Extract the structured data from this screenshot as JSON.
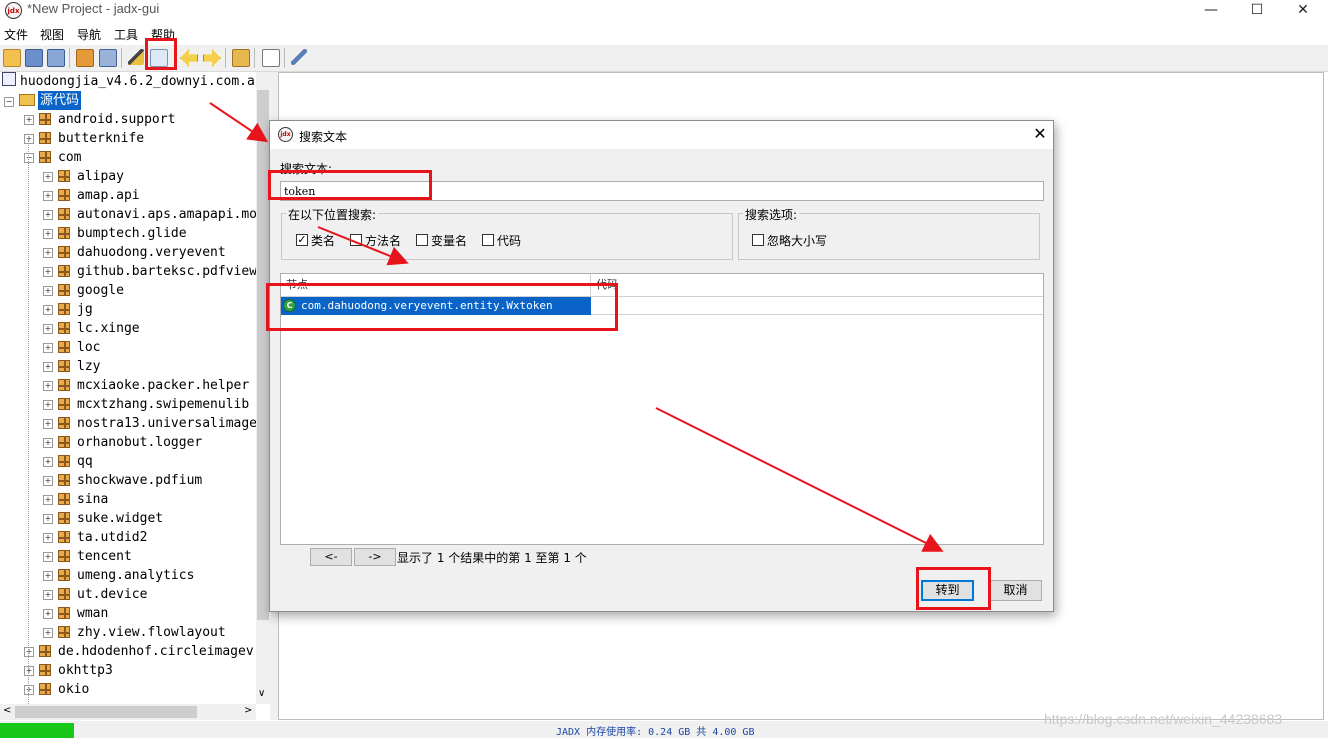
{
  "window": {
    "title": "*New Project - jadx-gui",
    "logo_text": "jdx",
    "minimize": "—",
    "maximize": "☐",
    "close": "✕"
  },
  "menu": [
    "文件",
    "视图",
    "导航",
    "工具",
    "帮助"
  ],
  "toolbar": {
    "icons": [
      "open-folder-icon",
      "add-files-icon",
      "save-all-icon",
      "sync-icon",
      "flatten-packages-icon",
      "decompile-wand-icon",
      "search-text-icon",
      "back-icon",
      "forward-icon",
      "deobfuscate-icon",
      "log-icon",
      "preferences-icon"
    ]
  },
  "tree": {
    "root_label": "huodongjia_v4.6.2_downyi.com.a",
    "source_label": "源代码",
    "items": [
      {
        "label": "android.support",
        "level": 1
      },
      {
        "label": "butterknife",
        "level": 1
      },
      {
        "label": "com",
        "level": 1,
        "expanded": true
      },
      {
        "label": "alipay",
        "level": 2
      },
      {
        "label": "amap.api",
        "level": 2
      },
      {
        "label": "autonavi.aps.amapapi.mo",
        "level": 2
      },
      {
        "label": "bumptech.glide",
        "level": 2
      },
      {
        "label": "dahuodong.veryevent",
        "level": 2
      },
      {
        "label": "github.barteksc.pdfview",
        "level": 2
      },
      {
        "label": "google",
        "level": 2
      },
      {
        "label": "jg",
        "level": 2
      },
      {
        "label": "lc.xinge",
        "level": 2
      },
      {
        "label": "loc",
        "level": 2
      },
      {
        "label": "lzy",
        "level": 2
      },
      {
        "label": "mcxiaoke.packer.helper",
        "level": 2
      },
      {
        "label": "mcxtzhang.swipemenulib",
        "level": 2
      },
      {
        "label": "nostra13.universalimage",
        "level": 2
      },
      {
        "label": "orhanobut.logger",
        "level": 2
      },
      {
        "label": "qq",
        "level": 2
      },
      {
        "label": "shockwave.pdfium",
        "level": 2
      },
      {
        "label": "sina",
        "level": 2
      },
      {
        "label": "suke.widget",
        "level": 2
      },
      {
        "label": "ta.utdid2",
        "level": 2
      },
      {
        "label": "tencent",
        "level": 2
      },
      {
        "label": "umeng.analytics",
        "level": 2
      },
      {
        "label": "ut.device",
        "level": 2
      },
      {
        "label": "wman",
        "level": 2
      },
      {
        "label": "zhy.view.flowlayout",
        "level": 2
      },
      {
        "label": "de.hdodenhof.circleimagev",
        "level": 1
      },
      {
        "label": "okhttp3",
        "level": 1
      },
      {
        "label": "okio",
        "level": 1
      }
    ]
  },
  "dialog": {
    "title": "搜索文本",
    "logo_text": "jdx",
    "close": "✕",
    "search_label": "搜索文本:",
    "search_value": "token",
    "location_group": "在以下位置搜索:",
    "options_group": "搜索选项:",
    "checkboxes": [
      {
        "label": "类名",
        "checked": true
      },
      {
        "label": "方法名",
        "checked": false
      },
      {
        "label": "变量名",
        "checked": false
      },
      {
        "label": "代码",
        "checked": false
      }
    ],
    "ignore_case": {
      "label": "忽略大小写",
      "checked": false
    },
    "columns": [
      "节点",
      "代码"
    ],
    "result": {
      "icon": "class-icon",
      "icon_letter": "C",
      "text": "com.dahuodong.veryevent.entity.Wxtoken"
    },
    "prev": "<-",
    "next": "->",
    "results_info": "显示了 1 个结果中的第 1 至第 1 个",
    "goto": "转到",
    "cancel": "取消"
  },
  "status": {
    "memory": "JADX 内存使用率: 0.24 GB 共 4.00 GB",
    "watermark": "https://blog.csdn.net/weixin_44238683"
  },
  "colors": {
    "selection": "#0a64c8",
    "annotation_red": "#e8141c",
    "memory_green": "#18c818"
  }
}
